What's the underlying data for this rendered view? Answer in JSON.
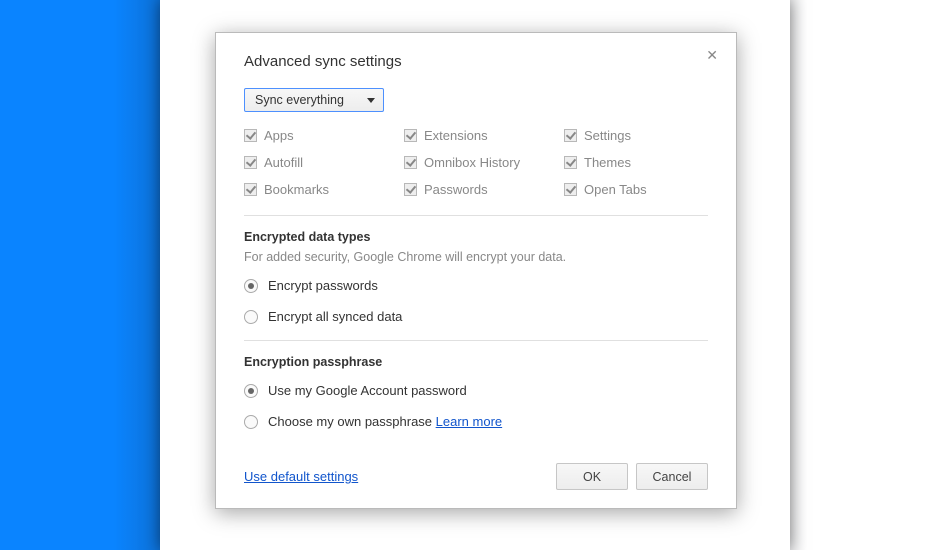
{
  "dialog": {
    "title": "Advanced sync settings",
    "close_glyph": "✕",
    "sync_dropdown": {
      "selected": "Sync everything"
    },
    "checkboxes": {
      "col1": [
        {
          "label": "Apps",
          "checked": true
        },
        {
          "label": "Autofill",
          "checked": true
        },
        {
          "label": "Bookmarks",
          "checked": true
        }
      ],
      "col2": [
        {
          "label": "Extensions",
          "checked": true
        },
        {
          "label": "Omnibox History",
          "checked": true
        },
        {
          "label": "Passwords",
          "checked": true
        }
      ],
      "col3": [
        {
          "label": "Settings",
          "checked": true
        },
        {
          "label": "Themes",
          "checked": true
        },
        {
          "label": "Open Tabs",
          "checked": true
        }
      ]
    },
    "encrypted_section": {
      "title": "Encrypted data types",
      "desc": "For added security, Google Chrome will encrypt your data.",
      "options": [
        {
          "label": "Encrypt passwords",
          "selected": true
        },
        {
          "label": "Encrypt all synced data",
          "selected": false
        }
      ]
    },
    "passphrase_section": {
      "title": "Encryption passphrase",
      "options": [
        {
          "label": "Use my Google Account password",
          "selected": true
        },
        {
          "label": "Choose my own passphrase",
          "selected": false,
          "link": "Learn more"
        }
      ]
    },
    "footer": {
      "default_link": "Use default settings",
      "ok": "OK",
      "cancel": "Cancel"
    }
  }
}
